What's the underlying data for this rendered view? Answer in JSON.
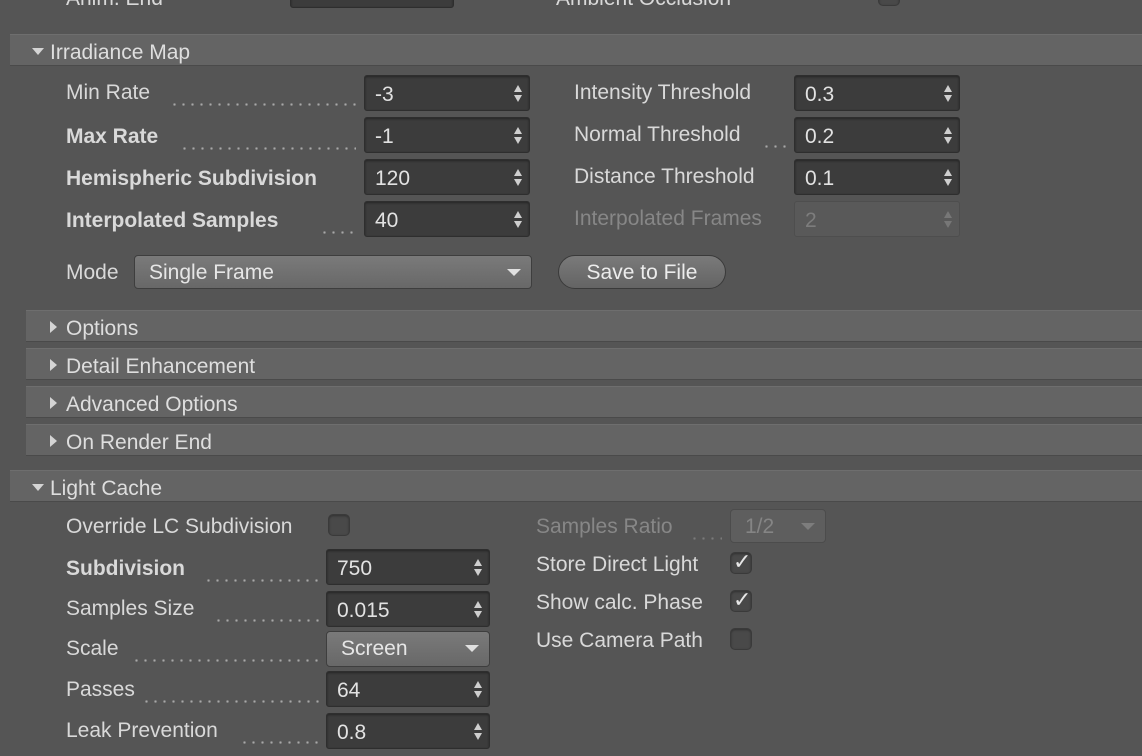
{
  "top_partial": {
    "left_label": "Anim. End",
    "right_label": "Ambient Occlusion"
  },
  "irradiance": {
    "title": "Irradiance Map",
    "min_rate": {
      "label": "Min Rate",
      "value": "-3"
    },
    "max_rate": {
      "label": "Max Rate",
      "value": "-1"
    },
    "hemispheric": {
      "label": "Hemispheric Subdivision",
      "value": "120"
    },
    "interp_samples": {
      "label": "Interpolated Samples",
      "value": "40"
    },
    "intensity": {
      "label": "Intensity Threshold",
      "value": "0.3"
    },
    "normal": {
      "label": "Normal Threshold",
      "value": "0.2"
    },
    "distance": {
      "label": "Distance Threshold",
      "value": "0.1"
    },
    "interp_frames": {
      "label": "Interpolated Frames",
      "value": "2"
    },
    "mode": {
      "label": "Mode",
      "value": "Single Frame"
    },
    "save_button": "Save to File"
  },
  "subsections": {
    "options": "Options",
    "detail": "Detail Enhancement",
    "advanced": "Advanced Options",
    "on_render_end": "On Render End"
  },
  "light_cache": {
    "title": "Light Cache",
    "override": {
      "label": "Override LC Subdivision",
      "checked": false
    },
    "subdivision": {
      "label": "Subdivision",
      "value": "750"
    },
    "samples_size": {
      "label": "Samples Size",
      "value": "0.015"
    },
    "scale": {
      "label": "Scale",
      "value": "Screen"
    },
    "passes": {
      "label": "Passes",
      "value": "64"
    },
    "leak": {
      "label": "Leak Prevention",
      "value": "0.8"
    },
    "samples_ratio": {
      "label": "Samples Ratio",
      "value": "1/2"
    },
    "store_direct": {
      "label": "Store Direct Light",
      "checked": true,
      "mark": "✓"
    },
    "show_calc": {
      "label": "Show calc. Phase",
      "checked": true,
      "mark": "✓"
    },
    "camera_path": {
      "label": "Use Camera Path",
      "checked": false
    }
  },
  "icons": [
    "disclosure-triangle-down-icon",
    "disclosure-triangle-right-icon",
    "spinner-arrows-icon",
    "dropdown-caret-icon",
    "checkmark-icon"
  ]
}
